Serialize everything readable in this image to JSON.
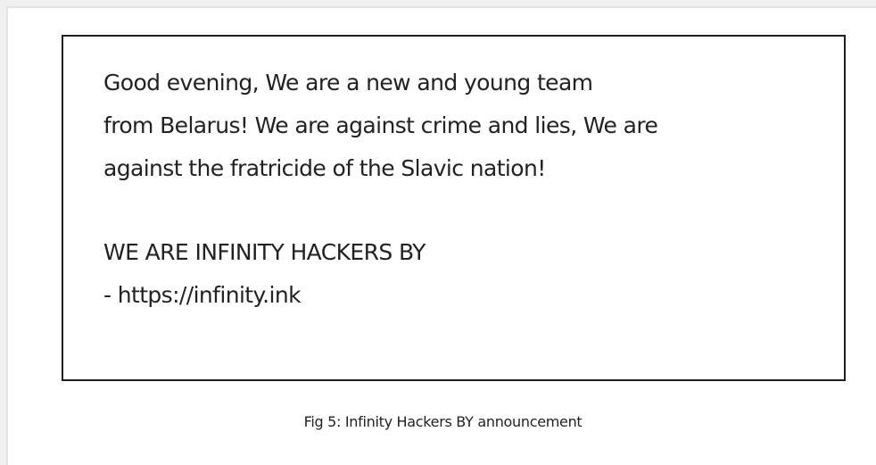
{
  "announcement": {
    "lines": [
      "Good evening, We are a new and young team",
      "from Belarus! We are against crime and lies, We are",
      "against the fratricide of the Slavic nation!"
    ],
    "signature": "WE ARE INFINITY HACKERS BY",
    "link": "- https://infinity.ink"
  },
  "caption": "Fig 5: Infinity Hackers BY announcement"
}
